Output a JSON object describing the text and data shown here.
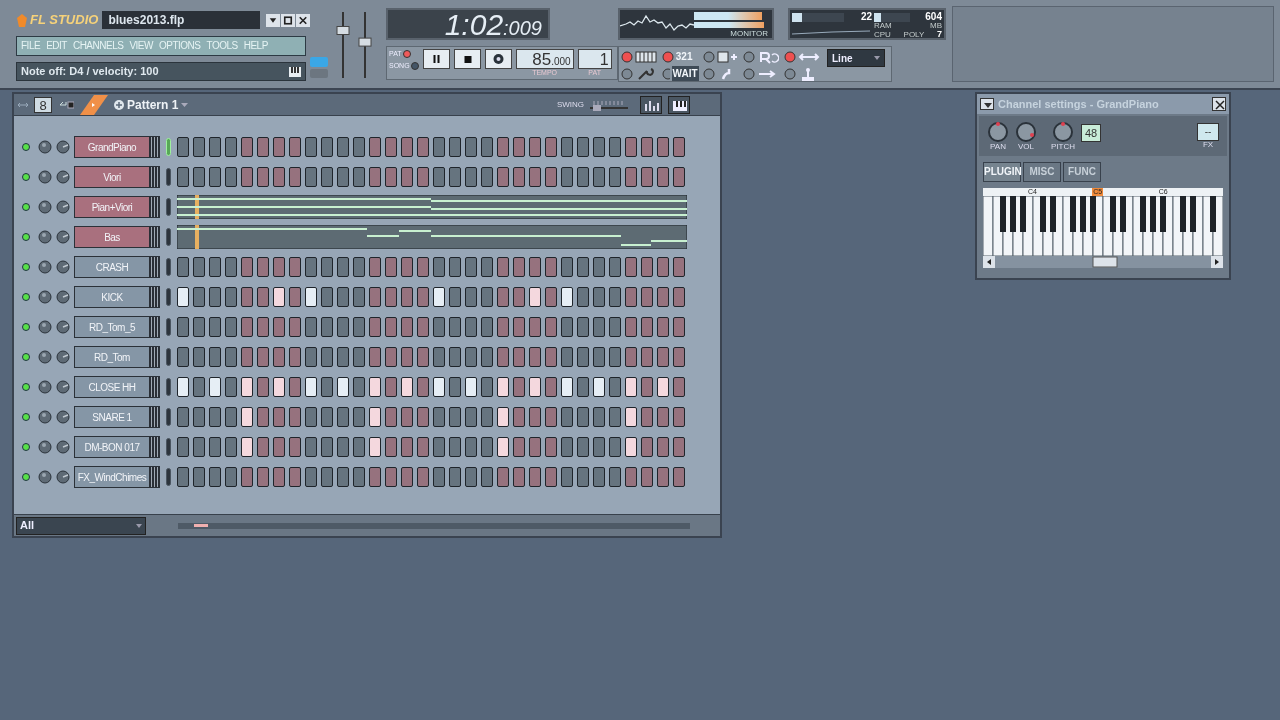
{
  "app": {
    "logo": "FL STUDIO",
    "project_title": "blues2013.flp"
  },
  "menu": [
    "FILE",
    "EDIT",
    "CHANNELS",
    "VIEW",
    "OPTIONS",
    "TOOLS",
    "HELP"
  ],
  "hint_bar": {
    "text": "Note off: D4 / velocity: 100"
  },
  "time_display": {
    "main": "1:02",
    "fraction": ":009"
  },
  "transport": {
    "modes": [
      {
        "label": "PAT",
        "selected": true
      },
      {
        "label": "SONG",
        "selected": false
      }
    ],
    "tempo": {
      "value": "85",
      "fraction": ".000",
      "label": "TEMPO"
    },
    "pattern": {
      "value": "1",
      "label": "PAT"
    }
  },
  "monitor": {
    "label": "MONITOR"
  },
  "master_sliders": [
    {
      "level": 0.75
    },
    {
      "level": 0.55
    }
  ],
  "performance": {
    "cpu": {
      "value": "22",
      "label": "CPU",
      "level": 0.2
    },
    "ram": {
      "value": "604",
      "label": "RAM",
      "unit": "MB",
      "level": 0.2
    },
    "poly": {
      "label": "POLY",
      "value": "7"
    }
  },
  "toolbar": {
    "items": [
      {
        "kind": "keyboard",
        "on": true
      },
      {
        "kind": "countdown",
        "on": true,
        "label": "321"
      },
      {
        "kind": "step-add",
        "on": false
      },
      {
        "kind": "loop-record",
        "on": false
      },
      {
        "kind": "blend",
        "on": true
      },
      {
        "kind": "wrench",
        "on": false
      },
      {
        "kind": "wait",
        "on": false,
        "label": "WAIT"
      },
      {
        "kind": "step-edit",
        "on": false
      },
      {
        "kind": "arrow",
        "on": false
      },
      {
        "kind": "joystick",
        "on": false
      }
    ],
    "snap": "Line"
  },
  "channel_rack": {
    "step_display": "8",
    "pattern": "Pattern 1",
    "swing": {
      "label": "SWING",
      "level": 0.1
    },
    "filter": "All",
    "channels": [
      {
        "name": "GrandPiano",
        "kind": "steps",
        "enabled": true,
        "highlighted": true,
        "selected": true,
        "steps": [
          false,
          false,
          false,
          false,
          false,
          false,
          false,
          false,
          false,
          false,
          false,
          false,
          false,
          false,
          false,
          false,
          false,
          false,
          false,
          false,
          false,
          false,
          false,
          false,
          false,
          false,
          false,
          false,
          false,
          false,
          false,
          false
        ]
      },
      {
        "name": "Viori",
        "kind": "steps",
        "enabled": true,
        "highlighted": true,
        "selected": false,
        "steps": [
          false,
          false,
          false,
          false,
          false,
          false,
          false,
          false,
          false,
          false,
          false,
          false,
          false,
          false,
          false,
          false,
          false,
          false,
          false,
          false,
          false,
          false,
          false,
          false,
          false,
          false,
          false,
          false,
          false,
          false,
          false,
          false
        ]
      },
      {
        "name": "Pian+Viori",
        "kind": "pianoroll",
        "enabled": true,
        "highlighted": true,
        "selected": false
      },
      {
        "name": "Bas",
        "kind": "pianoroll",
        "enabled": true,
        "highlighted": true,
        "selected": false
      },
      {
        "name": "CRASH",
        "kind": "steps",
        "enabled": true,
        "highlighted": false,
        "selected": false,
        "steps": [
          false,
          false,
          false,
          false,
          false,
          false,
          false,
          false,
          false,
          false,
          false,
          false,
          false,
          false,
          false,
          false,
          false,
          false,
          false,
          false,
          false,
          false,
          false,
          false,
          false,
          false,
          false,
          false,
          false,
          false,
          false,
          false
        ]
      },
      {
        "name": "KICK",
        "kind": "steps",
        "enabled": true,
        "highlighted": false,
        "selected": false,
        "steps": [
          true,
          false,
          false,
          false,
          false,
          false,
          true,
          false,
          true,
          false,
          false,
          false,
          false,
          false,
          false,
          false,
          true,
          false,
          false,
          false,
          false,
          false,
          true,
          false,
          true,
          false,
          false,
          false,
          false,
          false,
          false,
          false
        ]
      },
      {
        "name": "RD_Tom_5",
        "kind": "steps",
        "enabled": true,
        "highlighted": false,
        "selected": false,
        "steps": [
          false,
          false,
          false,
          false,
          false,
          false,
          false,
          false,
          false,
          false,
          false,
          false,
          false,
          false,
          false,
          false,
          false,
          false,
          false,
          false,
          false,
          false,
          false,
          false,
          false,
          false,
          false,
          false,
          false,
          false,
          false,
          false
        ]
      },
      {
        "name": "RD_Tom",
        "kind": "steps",
        "enabled": true,
        "highlighted": false,
        "selected": false,
        "steps": [
          false,
          false,
          false,
          false,
          false,
          false,
          false,
          false,
          false,
          false,
          false,
          false,
          false,
          false,
          false,
          false,
          false,
          false,
          false,
          false,
          false,
          false,
          false,
          false,
          false,
          false,
          false,
          false,
          false,
          false,
          false,
          false
        ]
      },
      {
        "name": "CLOSE HH",
        "kind": "steps",
        "enabled": true,
        "highlighted": false,
        "selected": false,
        "steps": [
          true,
          false,
          true,
          false,
          true,
          false,
          true,
          false,
          true,
          false,
          true,
          false,
          true,
          false,
          true,
          false,
          true,
          false,
          true,
          false,
          true,
          false,
          true,
          false,
          true,
          false,
          true,
          false,
          true,
          false,
          true,
          false
        ]
      },
      {
        "name": "SNARE 1",
        "kind": "steps",
        "enabled": true,
        "highlighted": false,
        "selected": false,
        "steps": [
          false,
          false,
          false,
          false,
          true,
          false,
          false,
          false,
          false,
          false,
          false,
          false,
          true,
          false,
          false,
          false,
          false,
          false,
          false,
          false,
          true,
          false,
          false,
          false,
          false,
          false,
          false,
          false,
          true,
          false,
          false,
          false
        ]
      },
      {
        "name": "DM-BON 017",
        "kind": "steps",
        "enabled": true,
        "highlighted": false,
        "selected": false,
        "steps": [
          false,
          false,
          false,
          false,
          true,
          false,
          false,
          false,
          false,
          false,
          false,
          false,
          true,
          false,
          false,
          false,
          false,
          false,
          false,
          false,
          true,
          false,
          false,
          false,
          false,
          false,
          false,
          false,
          true,
          false,
          false,
          false
        ]
      },
      {
        "name": "FX_WindChimes",
        "kind": "steps",
        "enabled": true,
        "highlighted": false,
        "selected": false,
        "steps": [
          false,
          false,
          false,
          false,
          false,
          false,
          false,
          false,
          false,
          false,
          false,
          false,
          false,
          false,
          false,
          false,
          false,
          false,
          false,
          false,
          false,
          false,
          false,
          false,
          false,
          false,
          false,
          false,
          false,
          false,
          false,
          false
        ]
      }
    ]
  },
  "channel_settings": {
    "title": "Channel settings - GrandPiano",
    "knobs": [
      "PAN",
      "VOL",
      "PITCH"
    ],
    "pitch_range": "48",
    "fx_label": "FX",
    "fx_value": "--",
    "tabs": [
      {
        "label": "PLUGIN",
        "selected": true
      },
      {
        "label": "MISC",
        "selected": false
      },
      {
        "label": "FUNC",
        "selected": false
      }
    ],
    "octave_labels": [
      {
        "label": "C4",
        "selected": false
      },
      {
        "label": "C5",
        "selected": true
      },
      {
        "label": "C6",
        "selected": false
      }
    ]
  }
}
